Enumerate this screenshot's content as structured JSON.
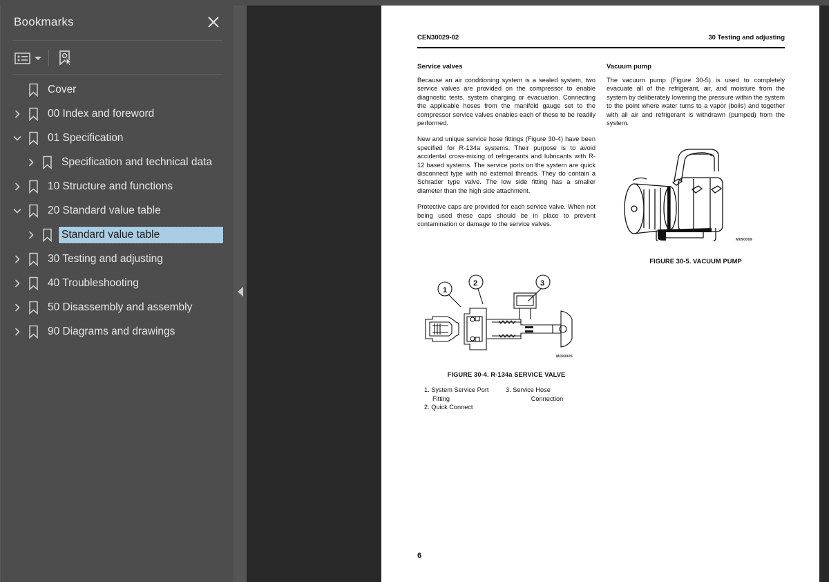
{
  "sidebar": {
    "title": "Bookmarks",
    "close_icon": "close-icon",
    "toolbar": {
      "options_icon": "list-options-icon",
      "options_caret": "chevron-down-icon",
      "new_bookmark_icon": "bookmark-select-icon"
    },
    "tree": [
      {
        "label": "Cover",
        "level": 0,
        "twisty": "none",
        "selected": false
      },
      {
        "label": "00 Index and foreword",
        "level": 0,
        "twisty": "collapsed",
        "selected": false
      },
      {
        "label": "01 Specification",
        "level": 0,
        "twisty": "expanded",
        "selected": false
      },
      {
        "label": "Specification and technical data",
        "level": 1,
        "twisty": "collapsed",
        "selected": false
      },
      {
        "label": "10 Structure and functions",
        "level": 0,
        "twisty": "collapsed",
        "selected": false
      },
      {
        "label": "20 Standard value table",
        "level": 0,
        "twisty": "expanded",
        "selected": false
      },
      {
        "label": "Standard value table",
        "level": 1,
        "twisty": "collapsed",
        "selected": true
      },
      {
        "label": "30 Testing and adjusting",
        "level": 0,
        "twisty": "collapsed",
        "selected": false
      },
      {
        "label": "40 Troubleshooting",
        "level": 0,
        "twisty": "collapsed",
        "selected": false
      },
      {
        "label": "50 Disassembly and assembly",
        "level": 0,
        "twisty": "collapsed",
        "selected": false
      },
      {
        "label": "90 Diagrams and drawings",
        "level": 0,
        "twisty": "collapsed",
        "selected": false
      }
    ],
    "collapse_handle_icon": "triangle-left-icon"
  },
  "document": {
    "header": {
      "left": "CEN30029-02",
      "right": "30 Testing and adjusting"
    },
    "left_column": {
      "heading": "Service valves",
      "paragraphs": [
        "Because an air conditioning system is a sealed system, two service valves are provided on the compressor to enable diagnostic tests, system charging or evacuation. Connecting the applicable hoses from the manifold gauge set to the compressor service valves enables each of these to be readily performed.",
        "New and unique service hose fittings (Figure 30-4) have been specified for R-134a systems. Their purpose is to avoid accidental cross-mixing of refrigerants and lubricants with R-12 based systems. The service ports on the system are quick disconnect type with no external threads. They do contain a Schrader type valve. The low side fitting has a smaller diameter than the high side attachment.",
        "Protective caps are provided for each service valve. When not being used these caps should be in place to prevent contamination or damage to the service valves."
      ],
      "figure": {
        "id_code": "M090005",
        "caption": "FIGURE 30-4. R-134a SERVICE VALVE",
        "callouts": [
          "1",
          "2",
          "3"
        ],
        "legend": [
          "1. System Service Port",
          "Fitting",
          "2. Quick Connect",
          "3. Service Hose",
          "Connection"
        ]
      }
    },
    "right_column": {
      "heading": "Vacuum pump",
      "paragraphs": [
        "The vacuum pump (Figure 30-5) is used to completely evacuate all of the refrigerant, air, and moisture from the system by deliberately lowering the pressure within the system to the point where water turns to a vapor (boils) and together with all air and refrigerant is withdrawn (pumped) from the system."
      ],
      "figure": {
        "id_code": "M090009",
        "caption": "FIGURE 30-5. VACUUM PUMP"
      }
    },
    "page_number": "6"
  }
}
